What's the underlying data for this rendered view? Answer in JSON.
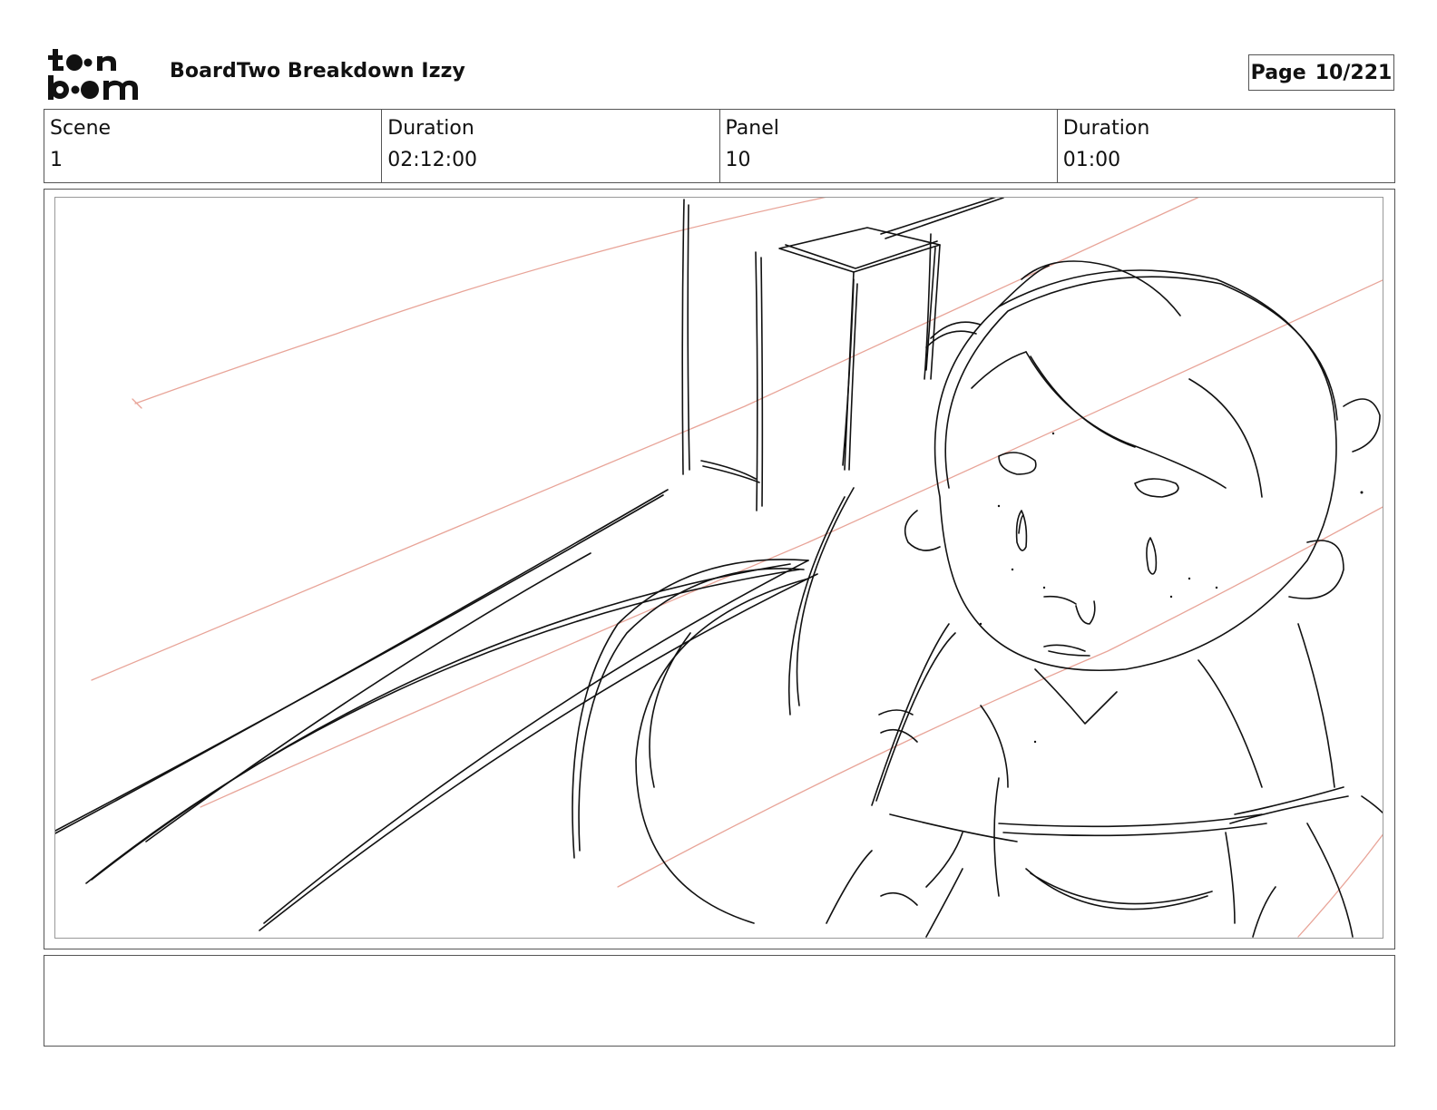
{
  "header": {
    "logo_text": "toon boom",
    "project_title": "BoardTwo Breakdown Izzy",
    "page_label": "Page",
    "page_number": "10/221"
  },
  "info": [
    {
      "label": "Scene",
      "value": "1"
    },
    {
      "label": "Duration",
      "value": "02:12:00"
    },
    {
      "label": "Panel",
      "value": "10"
    },
    {
      "label": "Duration",
      "value": "01:00"
    }
  ],
  "panel": {
    "image": "storyboard-sketch-girl-near-table"
  },
  "dialogue": {
    "text": ""
  },
  "colors": {
    "border": "#555555",
    "sketch_line": "#111111",
    "construction_line": "#e8a498"
  }
}
